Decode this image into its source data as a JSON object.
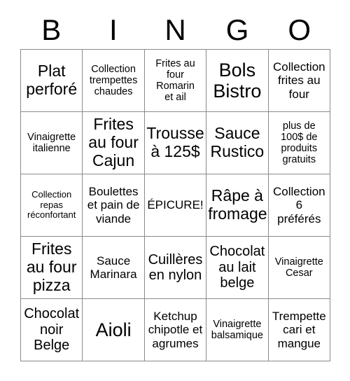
{
  "header": {
    "letters": [
      "B",
      "I",
      "N",
      "G",
      "O"
    ]
  },
  "grid": {
    "rows": [
      [
        {
          "text": "Plat\nperforé",
          "size": "fs-xl"
        },
        {
          "text": "Collection\ntrempettes\nchaudes",
          "size": "fs-sm"
        },
        {
          "text": "Frites au\nfour\nRomarin\net ail",
          "size": "fs-sm"
        },
        {
          "text": "Bols\nBistro",
          "size": "fs-xxl"
        },
        {
          "text": "Collection\nfrites au\nfour",
          "size": "fs-md"
        }
      ],
      [
        {
          "text": "Vinaigrette\nitalienne",
          "size": "fs-sm"
        },
        {
          "text": "Frites\nau four\nCajun",
          "size": "fs-xl"
        },
        {
          "text": "Trousse\nà 125$",
          "size": "fs-xl"
        },
        {
          "text": "Sauce\nRustico",
          "size": "fs-xl"
        },
        {
          "text": "plus de\n100$ de\nproduits\ngratuits",
          "size": "fs-sm"
        }
      ],
      [
        {
          "text": "Collection\nrepas\nréconfortant",
          "size": "fs-xs"
        },
        {
          "text": "Boulettes\net pain de\nviande",
          "size": "fs-md"
        },
        {
          "text": "ÉPICURE!",
          "size": "fs-md"
        },
        {
          "text": "Râpe à\nfromage",
          "size": "fs-xl"
        },
        {
          "text": "Collection\n6\npréférés",
          "size": "fs-md"
        }
      ],
      [
        {
          "text": "Frites\nau four\npizza",
          "size": "fs-xl"
        },
        {
          "text": "Sauce\nMarinara",
          "size": "fs-md"
        },
        {
          "text": "Cuillères\nen nylon",
          "size": "fs-lg"
        },
        {
          "text": "Chocolat\nau lait\nbelge",
          "size": "fs-lg"
        },
        {
          "text": "Vinaigrette\nCesar",
          "size": "fs-sm"
        }
      ],
      [
        {
          "text": "Chocolat\nnoir\nBelge",
          "size": "fs-lg"
        },
        {
          "text": "Aioli",
          "size": "fs-xxl"
        },
        {
          "text": "Ketchup\nchipotle et\nagrumes",
          "size": "fs-md"
        },
        {
          "text": "Vinaigrette\nbalsamique",
          "size": "fs-sm"
        },
        {
          "text": "Trempette\ncari et\nmangue",
          "size": "fs-md"
        }
      ]
    ]
  },
  "colors": {
    "background": "#ffffff",
    "text": "#000000",
    "grid_line": "#8a8a8a"
  }
}
